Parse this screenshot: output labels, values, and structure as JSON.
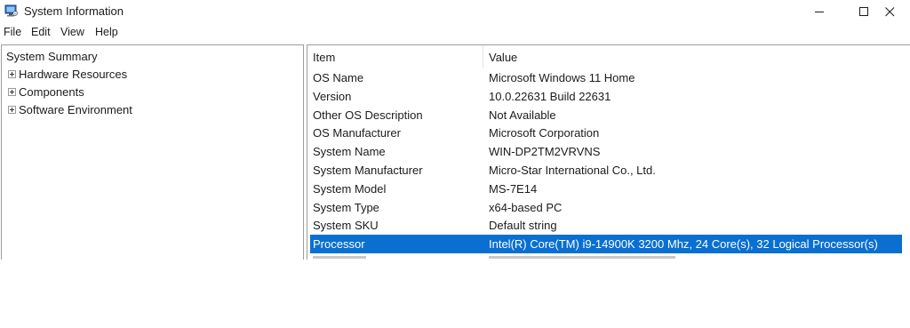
{
  "window": {
    "title": "System Information",
    "icon": "system-information-icon"
  },
  "menu": {
    "items": [
      "File",
      "Edit",
      "View",
      "Help"
    ]
  },
  "tree": {
    "root": "System Summary",
    "nodes": [
      "Hardware Resources",
      "Components",
      "Software Environment"
    ]
  },
  "table": {
    "headers": {
      "item": "Item",
      "value": "Value"
    },
    "rows": [
      {
        "item": "OS Name",
        "value": "Microsoft Windows 11 Home"
      },
      {
        "item": "Version",
        "value": "10.0.22631 Build 22631"
      },
      {
        "item": "Other OS Description",
        "value": "Not Available"
      },
      {
        "item": "OS Manufacturer",
        "value": "Microsoft Corporation"
      },
      {
        "item": "System Name",
        "value": "WIN-DP2TM2VRVNS"
      },
      {
        "item": "System Manufacturer",
        "value": "Micro-Star International Co., Ltd."
      },
      {
        "item": "System Model",
        "value": "MS-7E14"
      },
      {
        "item": "System Type",
        "value": "x64-based PC"
      },
      {
        "item": "System SKU",
        "value": "Default string"
      },
      {
        "item": "Processor",
        "value": "Intel(R) Core(TM) i9-14900K 3200 Mhz, 24 Core(s), 32 Logical Processor(s)"
      }
    ],
    "selected_row": "Processor"
  },
  "colors": {
    "selection": "#0a6fd1",
    "border": "#9d9d9d"
  }
}
